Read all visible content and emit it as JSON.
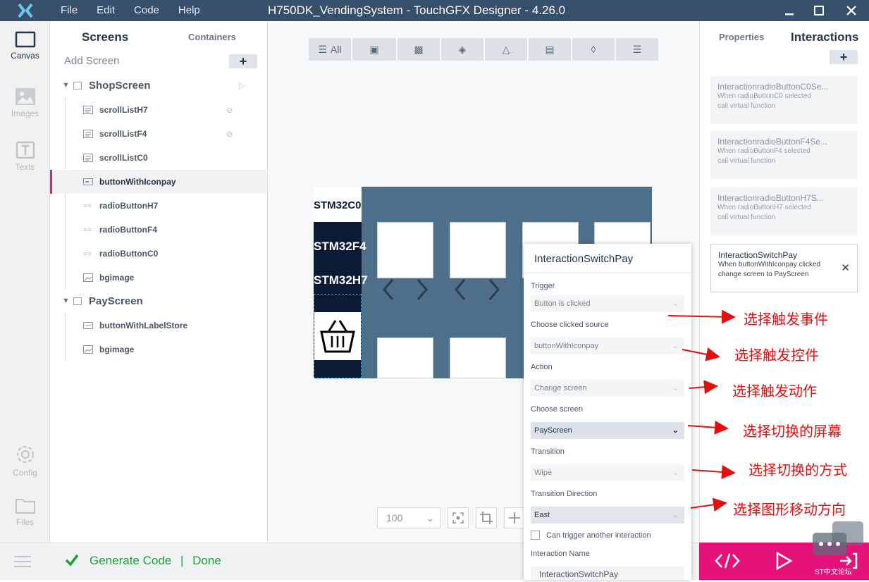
{
  "window": {
    "title": "H750DK_VendingSystem - TouchGFX Designer - 4.26.0",
    "menu": [
      "File",
      "Edit",
      "Code",
      "Help"
    ]
  },
  "nav": {
    "canvas": "Canvas",
    "images": "Images",
    "texts": "Texts",
    "config": "Config",
    "files": "Files"
  },
  "screens_panel": {
    "tab_screens": "Screens",
    "tab_containers": "Containers",
    "add_screen": "Add Screen",
    "plus": "+",
    "screens": [
      {
        "name": "ShopScreen",
        "items": [
          "scrollListH7",
          "scrollListF4",
          "scrollListC0",
          "buttonWithIconpay",
          "radioButtonH7",
          "radioButtonF4",
          "radioButtonC0",
          "bgimage"
        ]
      },
      {
        "name": "PayScreen",
        "items": [
          "buttonWithLabelStore",
          "bgimage"
        ]
      }
    ]
  },
  "toolbar": {
    "all_label": "All"
  },
  "canvas": {
    "labels": [
      "STM32C0",
      "STM32F4",
      "STM32H7"
    ]
  },
  "zoom": {
    "value": "100"
  },
  "status": {
    "generate": "Generate Code",
    "separator": "|",
    "done": "Done"
  },
  "right_panel": {
    "tab_properties": "Properties",
    "tab_interactions": "Interactions",
    "plus": "+",
    "cards": [
      {
        "title": "InteractionradioButtonC0Se...",
        "line1": "When radioButtonC0 selected",
        "line2": "call virtual function"
      },
      {
        "title": "InteractionradioButtonF4Se...",
        "line1": "When radioButtonF4 selected",
        "line2": "call virtual function"
      },
      {
        "title": "InteractionradioButtonH7S...",
        "line1": "When radioButtonH7 selected",
        "line2": "call virtual function"
      },
      {
        "title": "InteractionSwitchPay",
        "line1": "When buttonWithIconpay clicked",
        "line2": "change screen to PayScreen"
      }
    ]
  },
  "popup": {
    "title": "InteractionSwitchPay",
    "trigger_label": "Trigger",
    "trigger_value": "Button is clicked",
    "source_label": "Choose clicked source",
    "source_value": "buttonWithIconpay",
    "action_label": "Action",
    "action_value": "Change screen",
    "screen_label": "Choose screen",
    "screen_value": "PayScreen",
    "transition_label": "Transition",
    "transition_value": "Wipe",
    "direction_label": "Transition Direction",
    "direction_value": "East",
    "checkbox_label": "Can trigger another interaction",
    "name_label": "Interaction Name",
    "name_value": "InteractionSwitchPay"
  },
  "annotations": [
    "选择触发事件",
    "选择触发控件",
    "选择触发动作",
    "选择切换的屏幕",
    "选择切换的方式",
    "选择图形移动方向"
  ],
  "watermark": "ST中文论坛",
  "colors": {
    "titlebar": "#364f6b",
    "accent_magenta": "#e5127a",
    "status_green": "#1f9e3a",
    "annotation_red": "#e01010"
  }
}
